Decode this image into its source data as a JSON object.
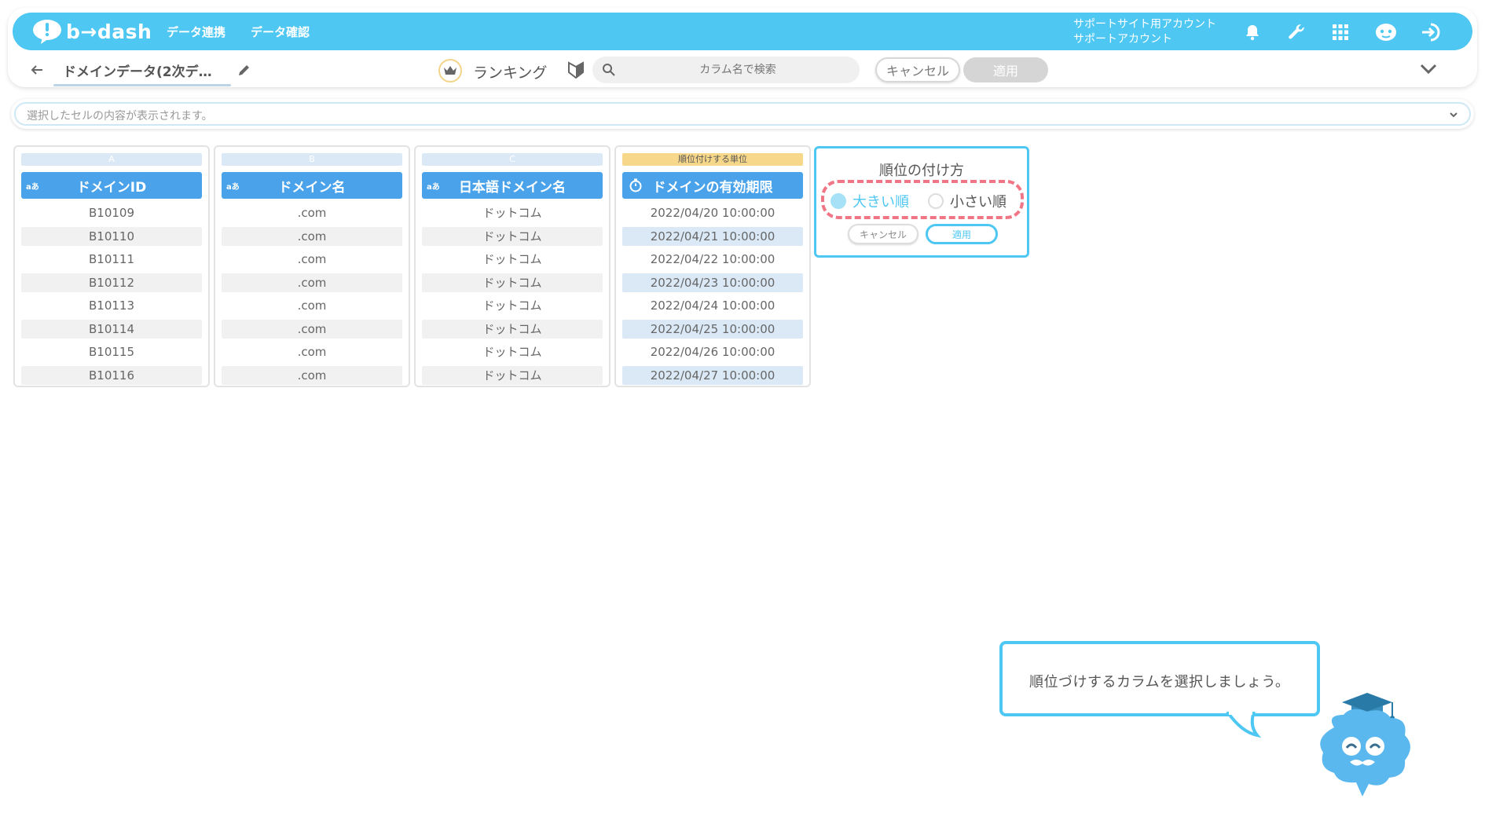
{
  "brand": {
    "logo_text": "b→dash",
    "accent": "#4ec7f3",
    "header_blue": "#4aa3ea",
    "highlight_red": "#f07585"
  },
  "nav": {
    "items": [
      "データ連携",
      "データ確認"
    ]
  },
  "account": {
    "line1": "サポートサイト用アカウント",
    "line2": "サポートアカウント"
  },
  "top_icons": [
    "bell-icon",
    "wrench-icon",
    "grid-icon",
    "assistant-icon",
    "logout-icon"
  ],
  "toolbar": {
    "title": "ドメインデータ(2次デ…",
    "ranking_label": "ランキング",
    "search_placeholder": "カラム名で検索",
    "cancel_label": "キャンセル",
    "apply_label": "適用"
  },
  "cell_bar": {
    "text": "選択したセルの内容が表示されます。"
  },
  "columns": [
    {
      "letter": "A",
      "type": "aあ",
      "header": "ドメインID",
      "cells": [
        "B10109",
        "B10110",
        "B10111",
        "B10112",
        "B10113",
        "B10114",
        "B10115",
        "B10116"
      ]
    },
    {
      "letter": "B",
      "type": "aあ",
      "header": "ドメイン名",
      "cells": [
        ".com",
        ".com",
        ".com",
        ".com",
        ".com",
        ".com",
        ".com",
        ".com"
      ]
    },
    {
      "letter": "C",
      "type": "aあ",
      "header": "日本語ドメイン名",
      "cells": [
        "ドットコム",
        "ドットコム",
        "ドットコム",
        "ドットコム",
        "ドットコム",
        "ドットコム",
        "ドットコム",
        "ドットコム"
      ]
    },
    {
      "letter": "順位付けする単位",
      "type": "timer",
      "header": "ドメインの有効期限",
      "cells": [
        "2022/04/20 10:00:00",
        "2022/04/21 10:00:00",
        "2022/04/22 10:00:00",
        "2022/04/23 10:00:00",
        "2022/04/24 10:00:00",
        "2022/04/25 10:00:00",
        "2022/04/26 10:00:00",
        "2022/04/27 10:00:00"
      ]
    }
  ],
  "popup": {
    "title": "順位の付け方",
    "options": [
      "大きい順",
      "小さい順"
    ],
    "selected": "大きい順",
    "cancel_label": "キャンセル",
    "apply_label": "適用"
  },
  "guide": {
    "text": "順位づけするカラムを選択しましょう。"
  }
}
